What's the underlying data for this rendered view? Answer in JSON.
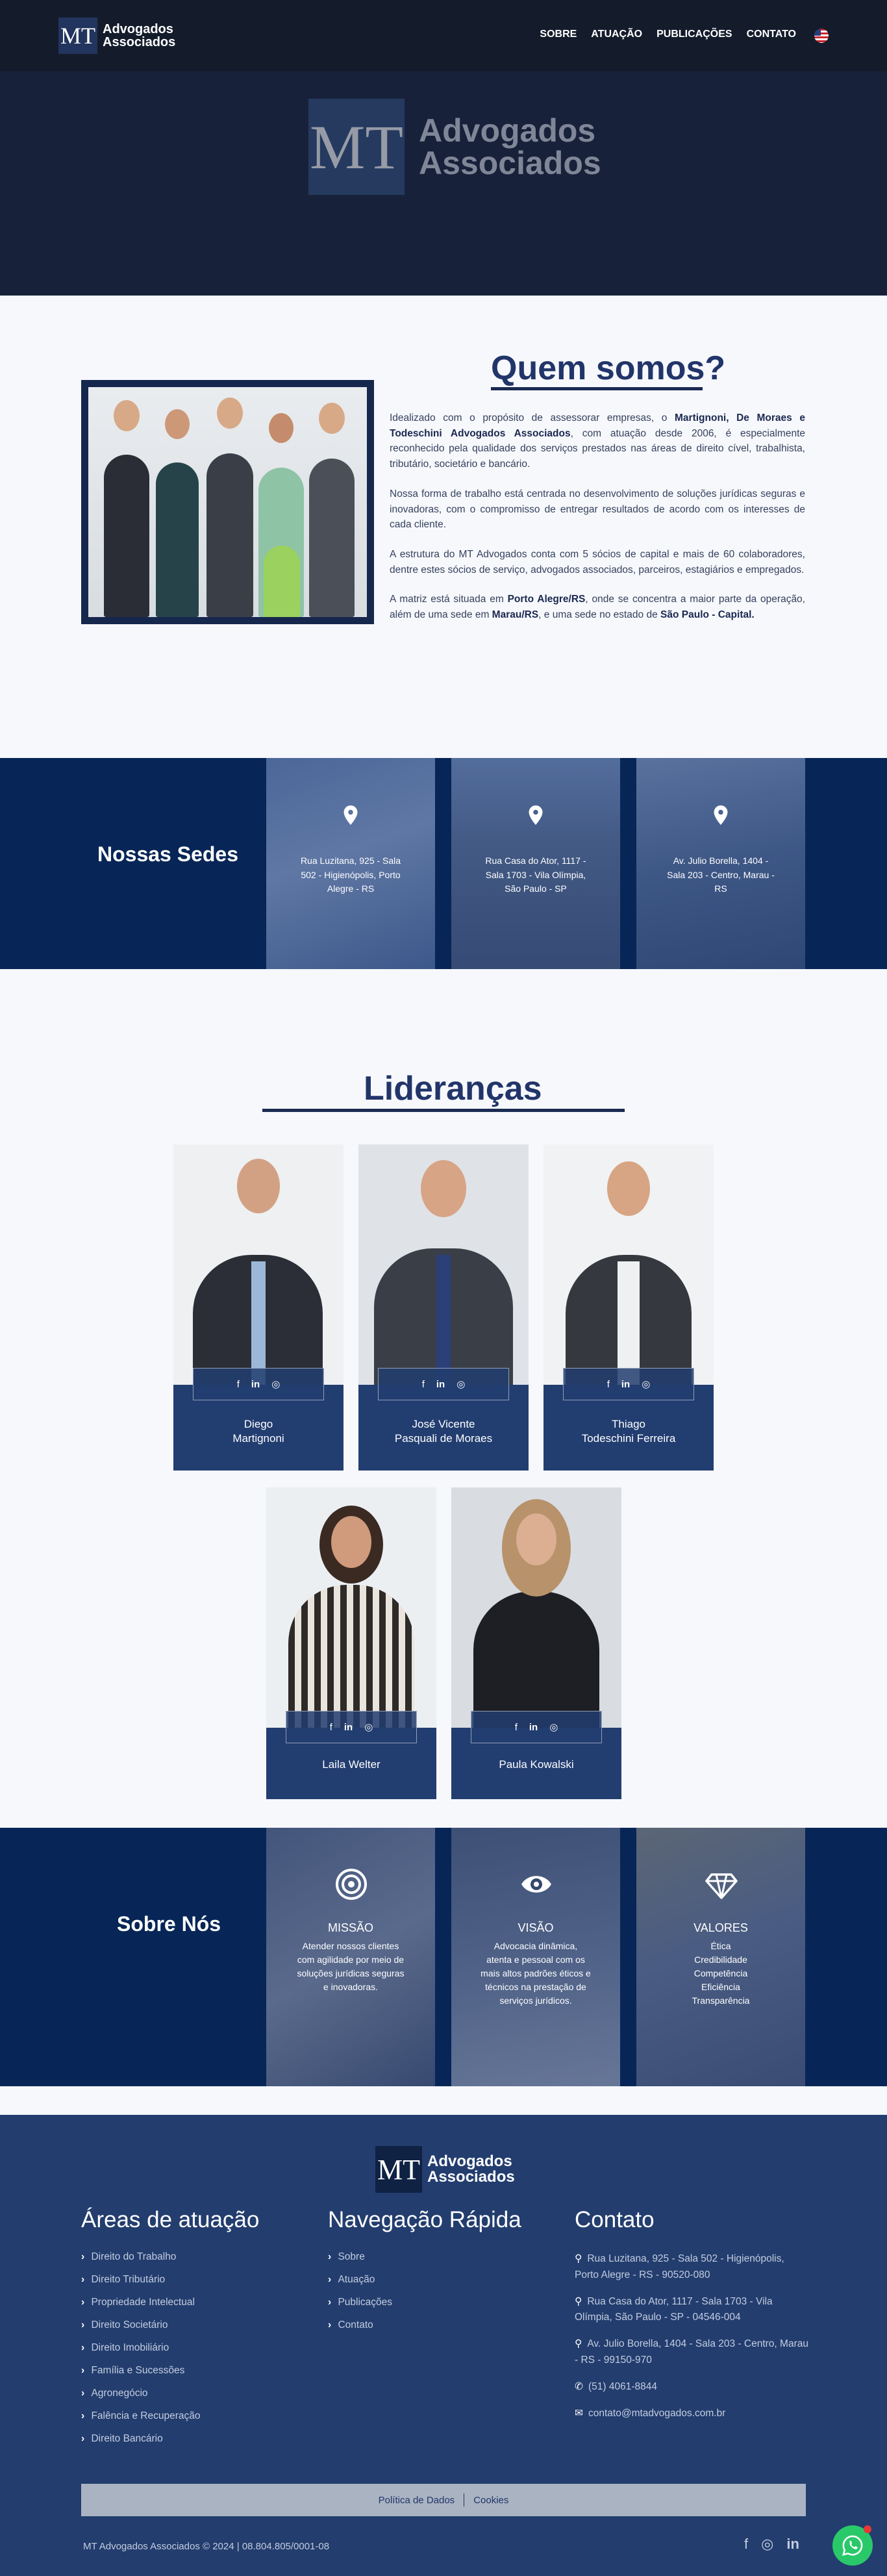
{
  "brand": {
    "mt": "MT",
    "name_line1": "Advogados",
    "name_line2": "Associados"
  },
  "nav": {
    "items": [
      "SOBRE",
      "ATUAÇÃO",
      "PUBLICAÇÕES",
      "CONTATO"
    ]
  },
  "about": {
    "title": "Quem somos?",
    "p1_pre": "Idealizado com o propósito de assessorar empresas, o ",
    "p1_bold": "Martignoni, De Moraes e Todeschini Advogados Associados",
    "p1_post": ", com atuação desde 2006, é especialmente reconhecido pela qualidade dos serviços prestados nas áreas de direito cível, trabalhista, tributário, societário e bancário.",
    "p2": "Nossa forma de trabalho está centrada no desenvolvimento de soluções jurídicas seguras e inovadoras, com o compromisso de entregar resultados de acordo com os interesses de cada cliente.",
    "p3": "A estrutura do MT Advogados conta com 5 sócios de capital e mais de 60 colaboradores, dentre estes sócios de serviço, advogados associados, parceiros, estagiários e empregados.",
    "p4_a": "A matriz está situada em ",
    "p4_b": "Porto Alegre/RS",
    "p4_c": ", onde se concentra a maior parte da operação, além de uma sede em ",
    "p4_d": "Marau/RS",
    "p4_e": ", e uma sede no estado de ",
    "p4_f": "São Paulo - Capital."
  },
  "sedes": {
    "title": "Nossas Sedes",
    "items": [
      "Rua Luzitana, 925 - Sala 502 - Higienópolis, Porto Alegre - RS",
      "Rua Casa do Ator, 1117 - Sala 1703 - Vila Olímpia, São Paulo - SP",
      "Av. Julio Borella, 1404 - Sala 203 - Centro, Marau - RS"
    ]
  },
  "leaders": {
    "title": "Lideranças",
    "items": [
      {
        "name1": "Diego",
        "name2": "Martignoni"
      },
      {
        "name1": "José Vicente",
        "name2": "Pasquali de Moraes"
      },
      {
        "name1": "Thiago",
        "name2": "Todeschini Ferreira"
      },
      {
        "name1": "Laila Welter",
        "name2": ""
      },
      {
        "name1": "Paula Kowalski",
        "name2": ""
      }
    ],
    "social_icons": [
      "facebook-icon",
      "linkedin-icon",
      "instagram-icon"
    ]
  },
  "sobre": {
    "title": "Sobre Nós",
    "cards": [
      {
        "title": "MISSÃO",
        "text": "Atender nossos clientes com agilidade por meio de soluções jurídicas seguras e inovadoras.",
        "icon": "target-icon"
      },
      {
        "title": "VISÃO",
        "text": "Advocacia dinâmica, atenta e pessoal com os mais altos padrões éticos e técnicos na prestação de serviços jurídicos.",
        "icon": "eye-icon"
      },
      {
        "title": "VALORES",
        "lines": [
          "Ética",
          "Credibilidade",
          "Competência",
          "Eficiência",
          "Transparência"
        ],
        "icon": "diamond-icon"
      }
    ]
  },
  "footer": {
    "areas_title": "Áreas de atuação",
    "areas": [
      "Direito do Trabalho",
      "Direito Tributário",
      "Propriedade Intelectual",
      "Direito Societário",
      "Direito Imobiliário",
      "Família e Sucessões",
      "Agronegócio",
      "Falência e Recuperação",
      "Direito Bancário"
    ],
    "nav_title": "Navegação Rápida",
    "nav": [
      "Sobre",
      "Atuação",
      "Publicações",
      "Contato"
    ],
    "contact_title": "Contato",
    "contacts": [
      "Rua Luzitana, 925 - Sala 502 - Higienópolis, Porto Alegre - RS - 90520-080",
      "Rua Casa do Ator, 1117 - Sala 1703 - Vila Olímpia, São Paulo - SP - 04546-004",
      "Av. Julio Borella, 1404 - Sala 203 - Centro, Marau - RS - 99150-970"
    ],
    "phone": "(51) 4061-8844",
    "email": "contato@mtadvogados.com.br",
    "legal": [
      "Política de Dados",
      "Cookies"
    ],
    "copyright": "MT Advogados Associados © 2024 | 08.804.805/0001-08"
  },
  "colors": {
    "navy": "#072657",
    "accent": "#22356a",
    "whatsapp": "#29c96a"
  }
}
